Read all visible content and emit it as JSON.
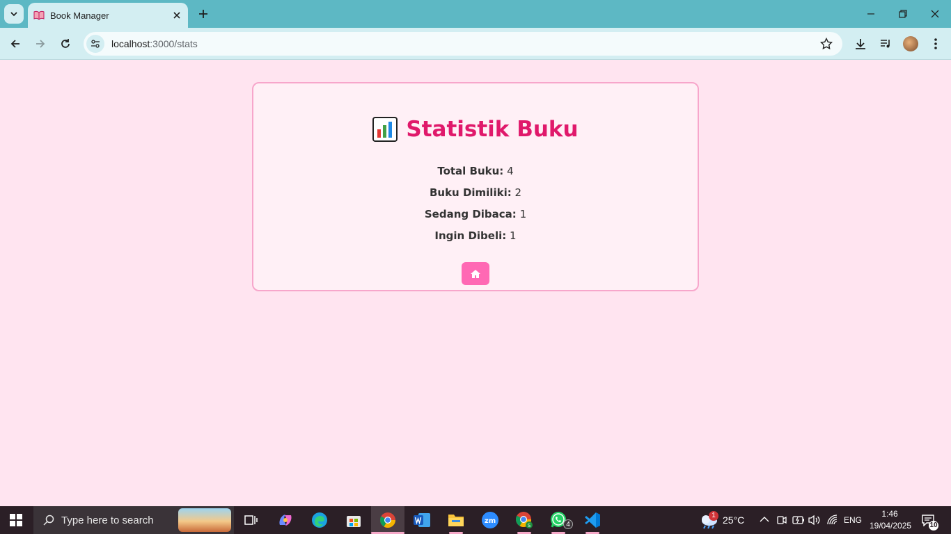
{
  "browser": {
    "tab_title": "Book Manager",
    "url_host": "localhost",
    "url_path": ":3000/stats"
  },
  "page": {
    "title": "Statistik Buku",
    "title_icon": "bar-chart-icon",
    "stats": [
      {
        "label": "Total Buku:",
        "value": "4"
      },
      {
        "label": "Buku Dimiliki:",
        "value": "2"
      },
      {
        "label": "Sedang Dibaca:",
        "value": "1"
      },
      {
        "label": "Ingin Dibeli:",
        "value": "1"
      }
    ],
    "home_button_icon": "home-icon"
  },
  "taskbar": {
    "search_placeholder": "Type here to search",
    "weather_temp": "25°C",
    "weather_badge": "1",
    "whatsapp_badge": "4",
    "language": "ENG",
    "time": "1:46",
    "date": "19/04/2025",
    "notification_count": "10"
  },
  "colors": {
    "background": "#ffe4f0",
    "accent": "#e0196b",
    "button": "#ff69b4",
    "card_border": "#f7a6cb"
  }
}
